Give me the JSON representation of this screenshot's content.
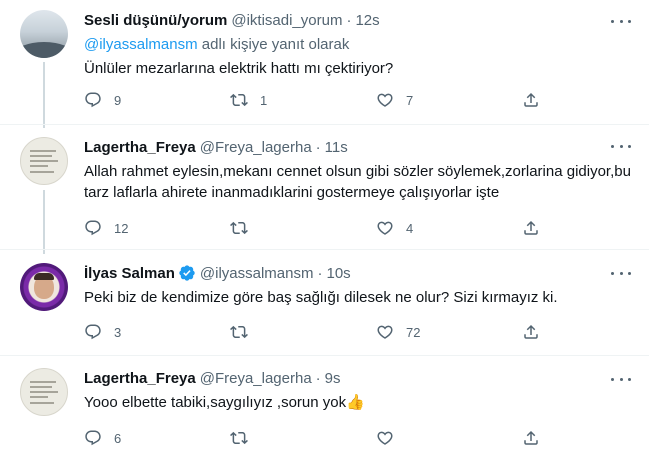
{
  "tweets": [
    {
      "name": "Sesli düşünü/yorum",
      "handle": "@iktisadi_yorum",
      "separator": "·",
      "time": "12s",
      "replying_prefix": "",
      "replying_mention": "@ilyassalmansm",
      "replying_suffix": " adlı kişiye yanıt olarak",
      "text": "Ünlüler mezarlarına elektrik hattı mı çektiriyor?",
      "replies": "9",
      "retweets": "1",
      "likes": "7"
    },
    {
      "name": "Lagertha_Freya",
      "handle": "@Freya_lagerha",
      "separator": "·",
      "time": "11s",
      "text": "Allah rahmet eylesin,mekanı cennet olsun gibi sözler söylemek,zorlarina gidiyor,bu tarz laflarla ahirete inanmadıklarini gostermeye çalışıyorlar işte",
      "replies": "12",
      "retweets": "",
      "likes": "4"
    },
    {
      "name": "İlyas Salman",
      "handle": "@ilyassalmansm",
      "separator": "·",
      "time": "10s",
      "text": "Peki biz de kendimize göre baş sağlığı dilesek ne olur? Sizi kırmayız ki.",
      "replies": "3",
      "retweets": "",
      "likes": "72"
    },
    {
      "name": "Lagertha_Freya",
      "handle": "@Freya_lagerha",
      "separator": "·",
      "time": "9s",
      "text": "Yooo elbette tabiki,saygılıyız ,sorun yok",
      "emoji": "👍",
      "replies": "6",
      "retweets": "",
      "likes": ""
    }
  ],
  "icons": {
    "reply": "reply-icon",
    "retweet": "retweet-icon",
    "like": "heart-icon",
    "share": "share-icon",
    "more": "more-icon",
    "verified": "verified-badge-icon"
  },
  "colors": {
    "accent": "#1d9bf0",
    "secondary_text": "#536471",
    "primary_text": "#0f1419"
  }
}
